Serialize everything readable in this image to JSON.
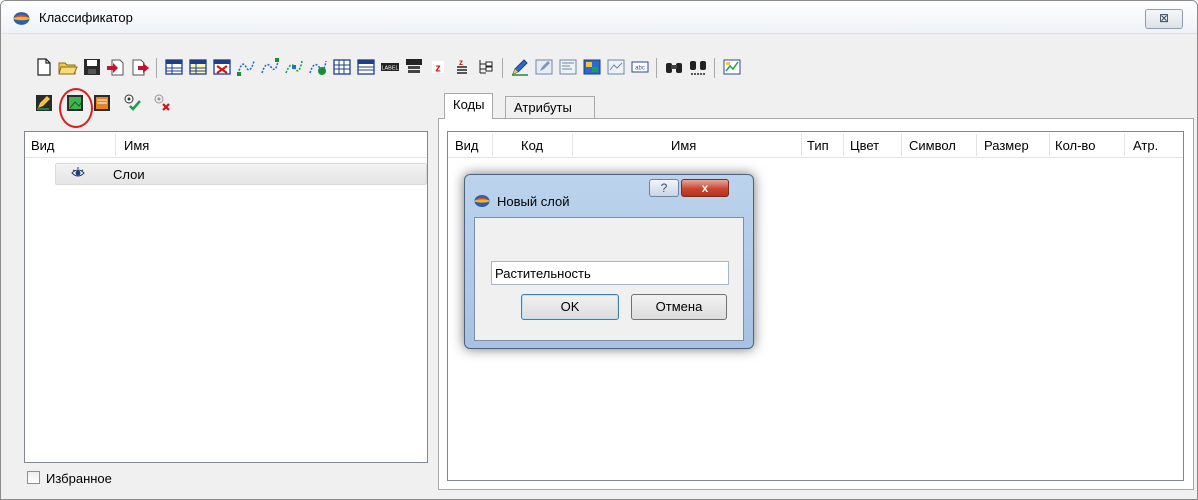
{
  "window": {
    "title": "Классификатор",
    "close_glyph": "⊠"
  },
  "toolbar1": {
    "icons": [
      "new-file-icon",
      "open-folder-icon",
      "save-icon",
      "import-icon",
      "export-icon",
      "table-icon",
      "table-yellow-icon",
      "table-red-icon",
      "curve-icon",
      "curve-blue-icon",
      "curve-green-icon",
      "curve-edit-icon",
      "grid-icon",
      "table-list-icon",
      "label-icon",
      "label-multi-icon",
      "z-icon",
      "z-list-icon",
      "tree-icon",
      "pencil-icon",
      "edit-object-icon",
      "properties-icon",
      "color-layers-icon",
      "layer-icon",
      "text-box-icon",
      "binoculars-icon",
      "binoculars-next-icon",
      "chart-icon"
    ]
  },
  "toolbar2": {
    "icons": [
      "edit-layer-icon",
      "new-layer-icon",
      "layer-properties-icon",
      "check-layer-icon",
      "delete-layer-icon"
    ]
  },
  "left_panel": {
    "columns": [
      "Вид",
      "Имя"
    ],
    "rows": [
      {
        "name": "Слои"
      }
    ],
    "favorites_label": "Избранное"
  },
  "tabs": [
    {
      "label": "Коды"
    },
    {
      "label": "Атрибуты"
    }
  ],
  "codes_table": {
    "columns": [
      "Вид",
      "Код",
      "Имя",
      "Тип",
      "Цвет",
      "Символ",
      "Размер",
      "Кол-во",
      "Атр."
    ]
  },
  "dialog": {
    "title": "Новый слой",
    "help_glyph": "?",
    "close_glyph": "x",
    "input_value": "Растительность",
    "ok_label": "OK",
    "cancel_label": "Отмена"
  },
  "colors": {
    "highlight_ring": "#d62020",
    "dialog_frame": "#a7c2e2",
    "close_button": "#c9462f"
  }
}
